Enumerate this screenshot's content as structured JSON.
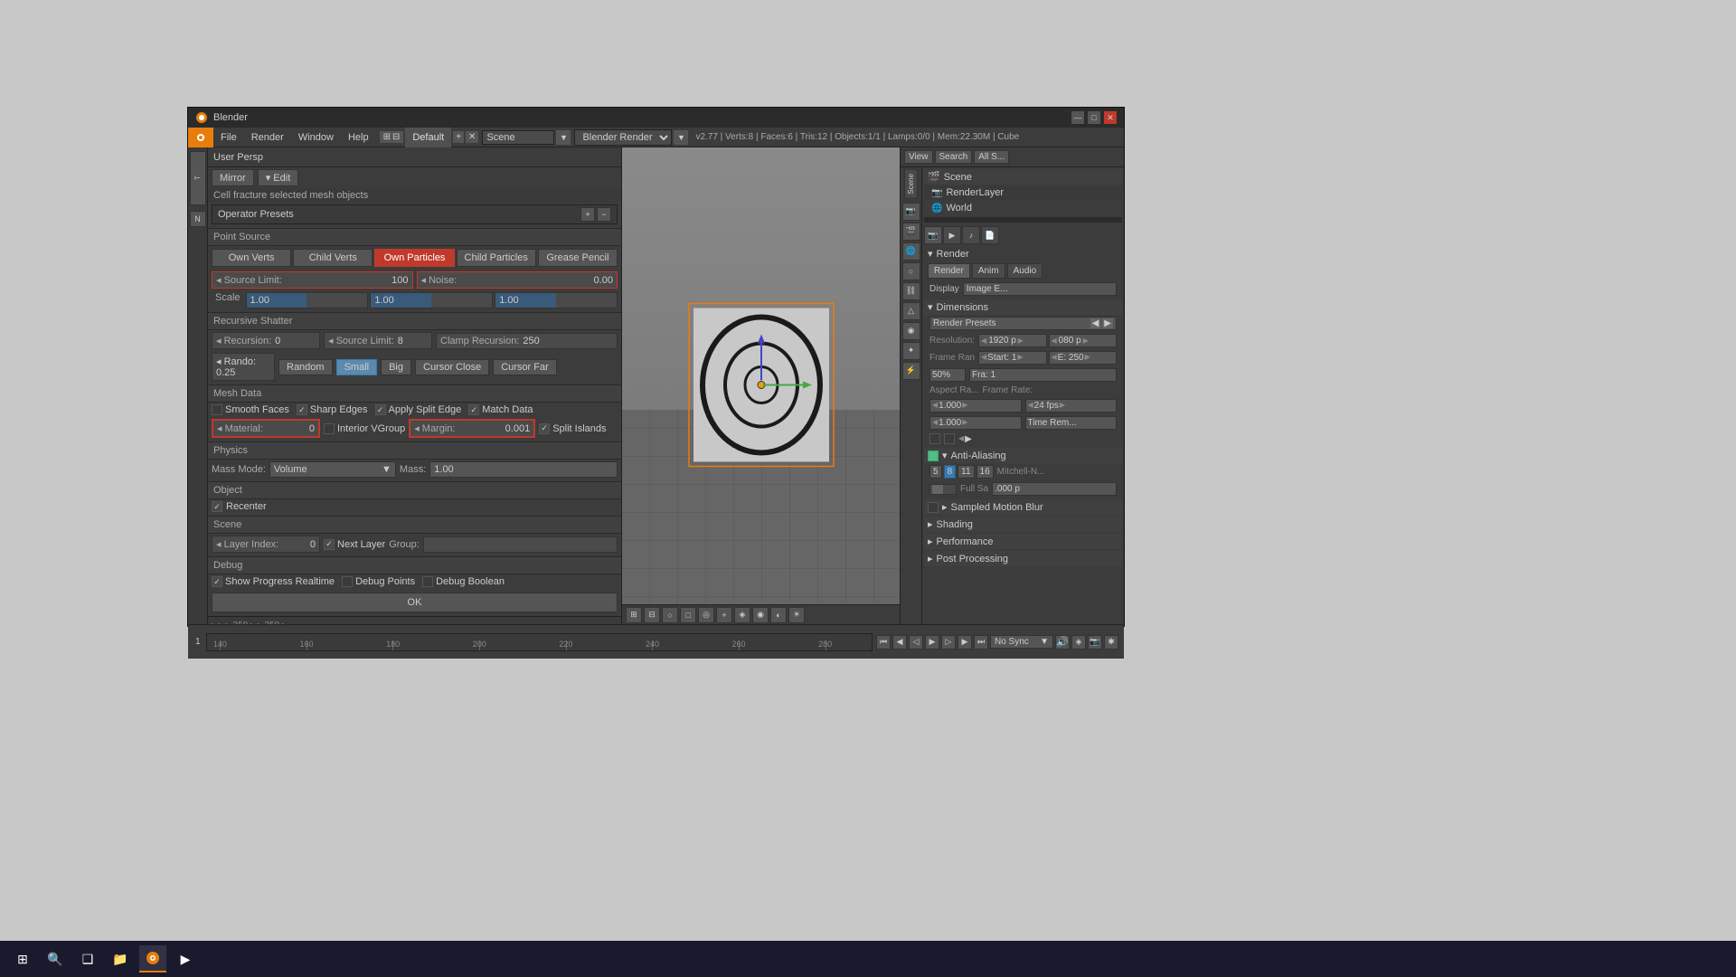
{
  "window": {
    "title": "Blender",
    "titlebar_buttons": [
      "—",
      "□",
      "✕"
    ]
  },
  "menubar": {
    "logo": "B",
    "menus": [
      "File",
      "Render",
      "Window",
      "Help"
    ],
    "workspace": "Default",
    "scene": "Scene",
    "render_engine": "Blender Render",
    "version_info": "v2.77 | Verts:8 | Faces:6 | Tris:12 | Objects:1/1 | Lamps:0/0 | Mem:22.30M | Cube"
  },
  "left_panel": {
    "view_label": "User Persp",
    "mirror_label": "Mirror",
    "edit_label": "▾ Edit",
    "cell_fracture_title": "Cell fracture selected mesh objects",
    "operator_presets": "Operator Presets",
    "point_source": {
      "header": "Point Source",
      "buttons": [
        "Own Verts",
        "Child Verts",
        "Own Particles",
        "Child Particles",
        "Grease Pencil"
      ],
      "active": "Own Particles"
    },
    "source_limit_label": "◂ Source Limit:",
    "source_limit_value": "100",
    "noise_label": "◂ Noise:",
    "noise_value": "0.00",
    "scale_label": "Scale",
    "scale_x": "1.00",
    "scale_y": "1.00",
    "scale_z": "1.00",
    "recursive_shatter": {
      "header": "Recursive Shatter",
      "recursion_label": "◂ Recursion:",
      "recursion_value": "0",
      "source_limit_label": "◂ Source Limit:",
      "source_limit_value": "8",
      "clamp_label": "Clamp Recursion:",
      "clamp_value": "250",
      "rando_label": "◂ Rando: 0.25",
      "buttons": [
        "Random",
        "Small",
        "Big",
        "Cursor Close",
        "Cursor Far"
      ],
      "active": "Small"
    },
    "mesh_data": {
      "header": "Mesh Data",
      "smooth_faces_label": "Smooth Faces",
      "smooth_faces_checked": false,
      "sharp_edges_label": "Sharp Edges",
      "sharp_edges_checked": true,
      "apply_split_edge_label": "Apply Split Edge",
      "apply_split_edge_checked": true,
      "match_data_label": "Match Data",
      "match_data_checked": true,
      "material_label": "◂ Material:",
      "material_value": "0",
      "interior_vgroup_label": "Interior VGroup",
      "interior_vgroup_checked": false,
      "margin_label": "◂ Margin:",
      "margin_value": "0.001",
      "split_islands_label": "Split Islands",
      "split_islands_checked": true
    },
    "physics": {
      "header": "Physics",
      "mass_mode_label": "Mass Mode:",
      "mass_mode_value": "Volume",
      "mass_label": "Mass:",
      "mass_value": "1.00"
    },
    "object": {
      "header": "Object",
      "recenter_label": "Recenter",
      "recenter_checked": true
    },
    "scene_section": {
      "header": "Scene",
      "layer_index_label": "◂ Layer Index:",
      "layer_index_value": "0",
      "next_layer_label": "Next Layer",
      "next_layer_checked": true,
      "group_label": "Group:",
      "group_value": ""
    },
    "debug": {
      "header": "Debug",
      "show_progress_label": "Show Progress Realtime",
      "show_progress_checked": true,
      "debug_points_label": "Debug Points",
      "debug_points_checked": false,
      "debug_boolean_label": "Debug Boolean",
      "debug_boolean_checked": false
    },
    "ok_button": "OK"
  },
  "viewport": {
    "label": "User Persp"
  },
  "right_panel": {
    "view_label": "View",
    "search_label": "Search",
    "all_label": "All S...",
    "scene_label": "Scene",
    "render_layer": "RenderLayer",
    "world": "World",
    "render": {
      "title": "Render",
      "tabs": [
        "Render",
        "Anim",
        "Audio"
      ],
      "display_label": "Display",
      "display_value": "Image E...",
      "dimensions": {
        "title": "Dimensions",
        "render_presets": "Render Presets",
        "resolution_x": "1920 p",
        "resolution_y": "080 p",
        "percent": "50%",
        "start_label": "Start: 1",
        "end_label": "E: 250",
        "fra_label": "Fra: 1",
        "aspect_x": "1.000",
        "aspect_y": "1.000",
        "frame_rate": "24 fps",
        "time_rem": "Time Rem..."
      },
      "anti_aliasing": {
        "title": "Anti-Aliasing",
        "values": [
          "5",
          "8",
          "11",
          "16"
        ],
        "full_sa": "Full Sa",
        "value": ".000 p"
      },
      "sampled_motion_blur": "Sampled Motion Blur",
      "shading": "Shading",
      "performance": "Performance",
      "post_processing": "Post Processing"
    }
  },
  "timeline": {
    "markers": [
      "140",
      "160",
      "180",
      "200",
      "220",
      "240",
      "260",
      "280"
    ],
    "sync": "No Sync",
    "frame": "1"
  },
  "taskbar": {
    "items": [
      "⊞",
      "🔍",
      "❑",
      "📁",
      "🟠",
      "▶"
    ]
  },
  "icons": {
    "blender_logo": "🟠",
    "scene_icon": "🎬",
    "render_layer_icon": "📷",
    "world_icon": "🌐"
  }
}
